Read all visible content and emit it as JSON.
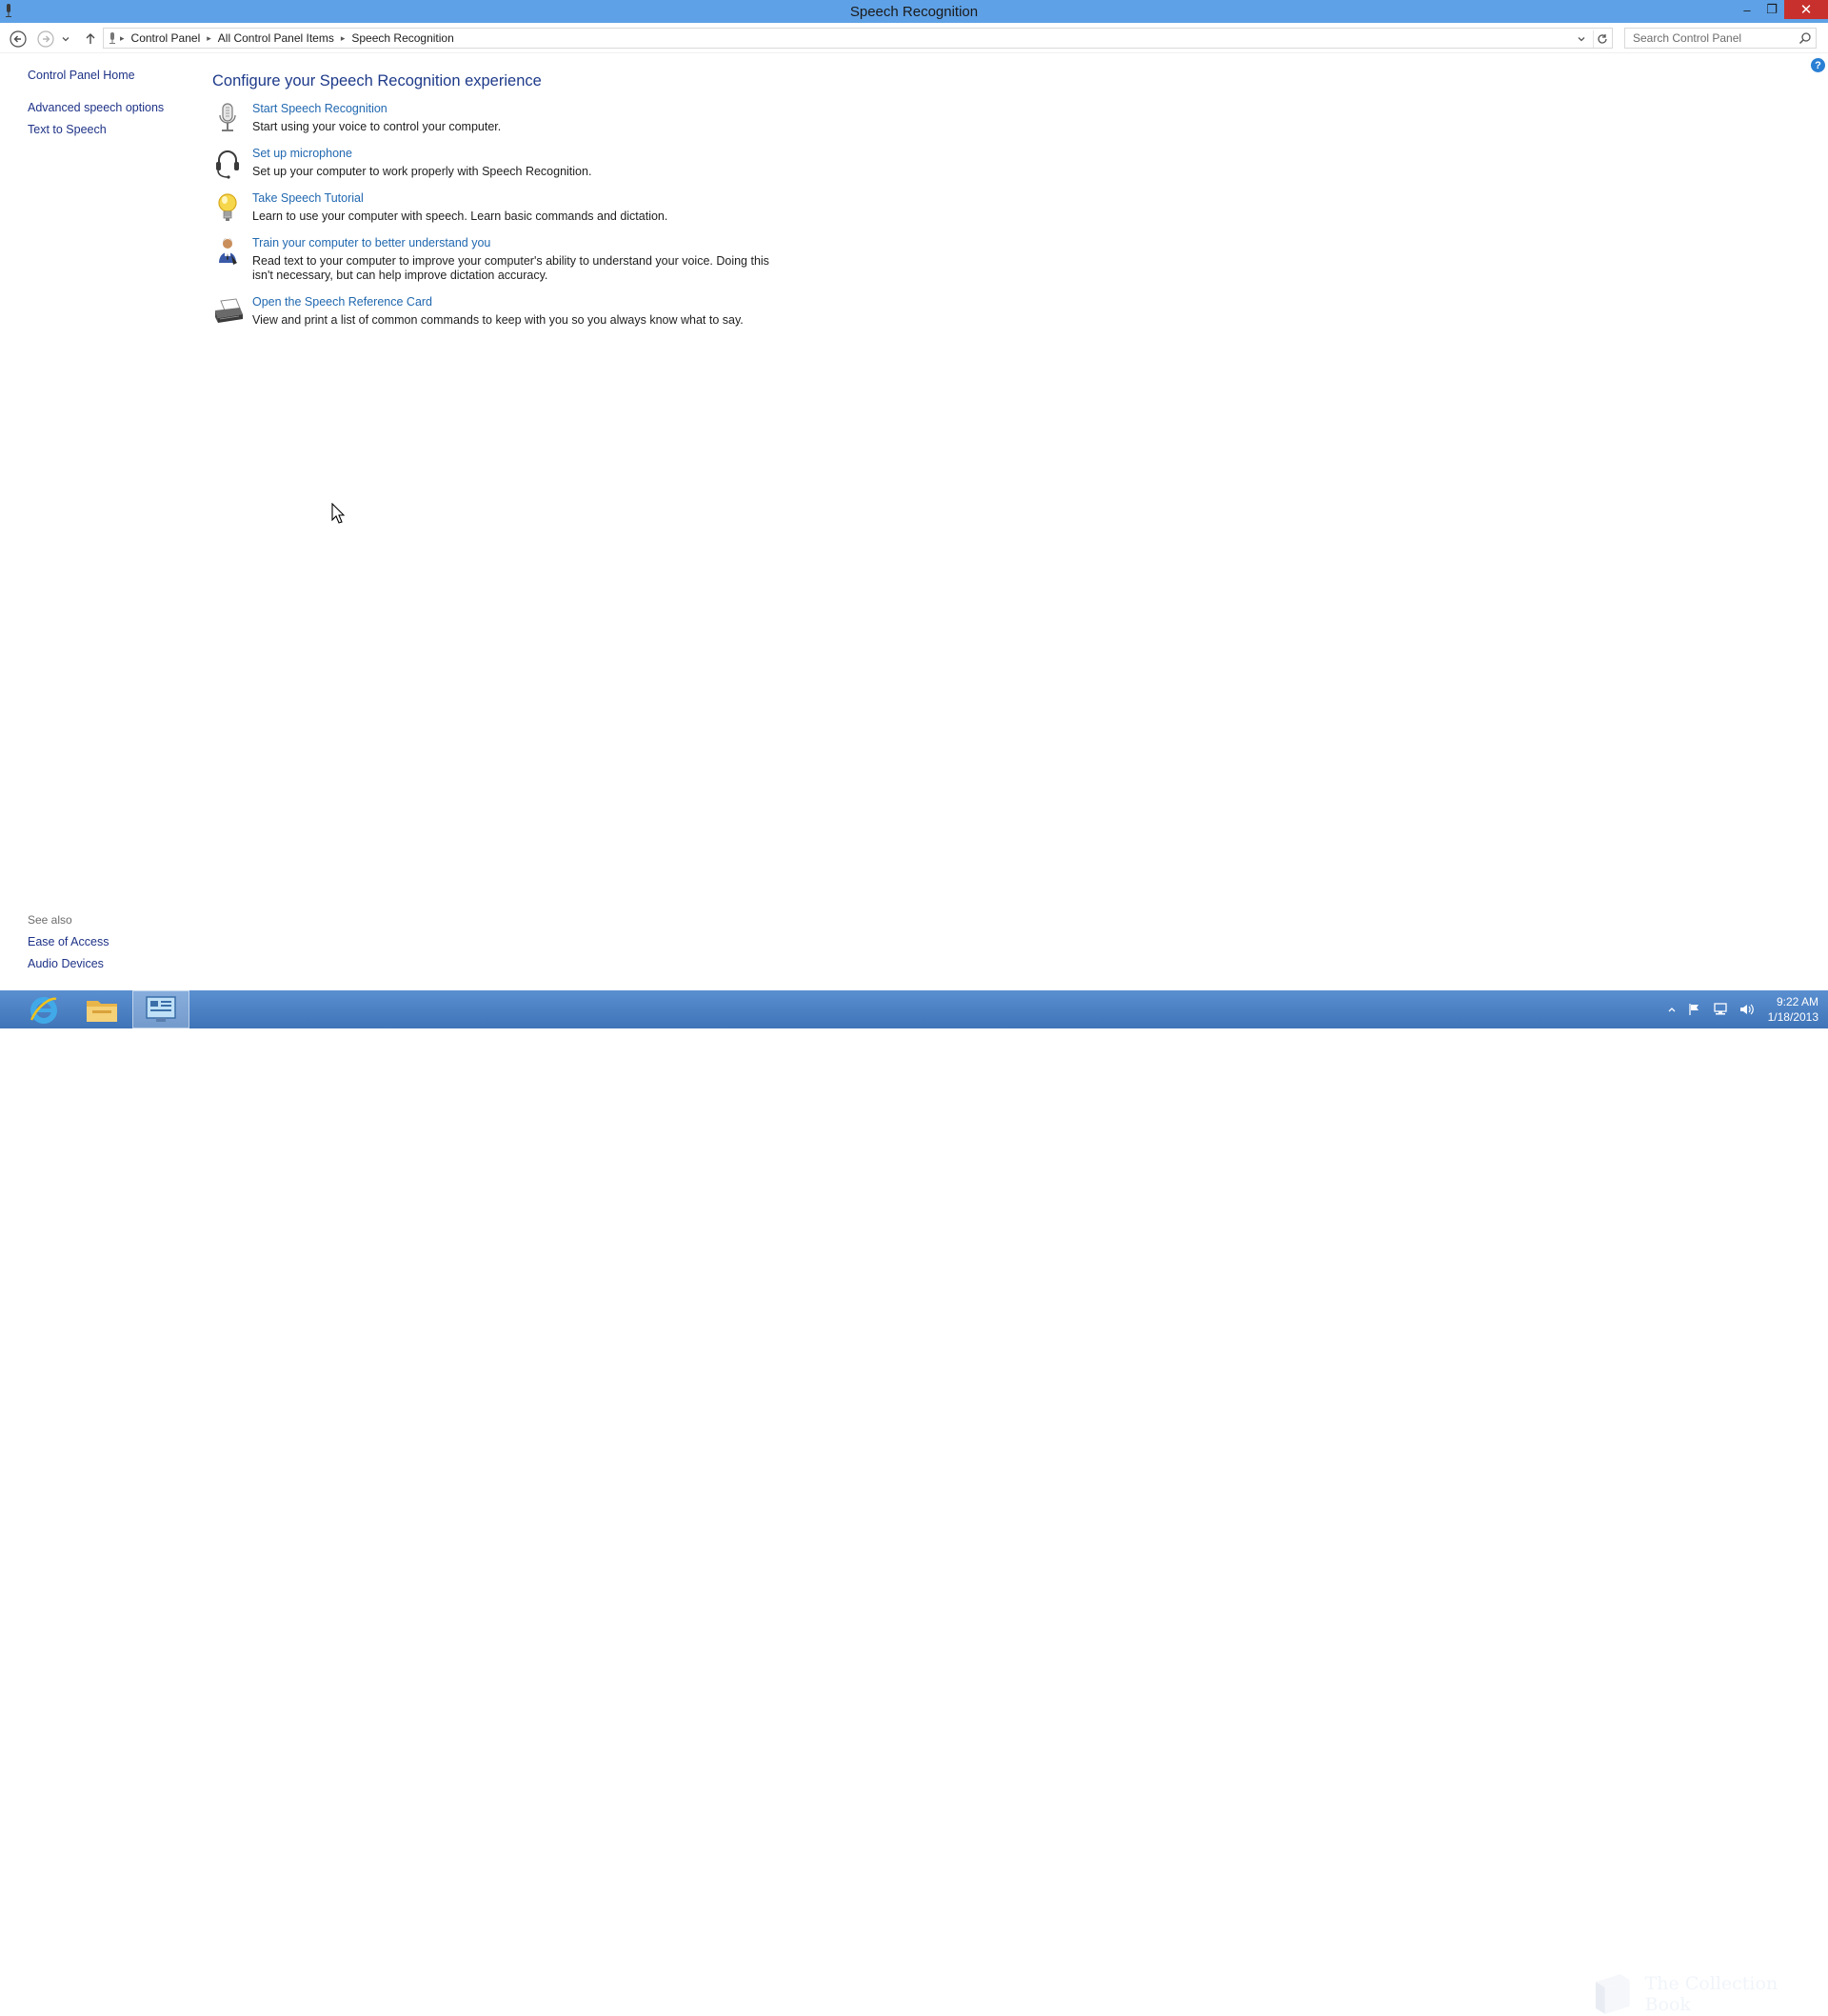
{
  "window": {
    "title": "Speech Recognition",
    "minimize_label": "–",
    "restore_label": "❐",
    "close_label": "✕"
  },
  "address": {
    "crumbs": [
      "Control Panel",
      "All Control Panel Items",
      "Speech Recognition"
    ],
    "search_placeholder": "Search Control Panel"
  },
  "sidebar": {
    "home": "Control Panel Home",
    "items": [
      "Advanced speech options",
      "Text to Speech"
    ],
    "see_also_title": "See also",
    "see_also": [
      "Ease of Access",
      "Audio Devices"
    ]
  },
  "main": {
    "title": "Configure your Speech Recognition experience",
    "tasks": [
      {
        "link": "Start Speech Recognition",
        "desc": "Start using your voice to control your computer.",
        "icon": "microphone-icon"
      },
      {
        "link": "Set up microphone",
        "desc": "Set up your computer to work properly with Speech Recognition.",
        "icon": "headset-icon"
      },
      {
        "link": "Take Speech Tutorial",
        "desc": "Learn to use your computer with speech.  Learn basic commands and dictation.",
        "icon": "lightbulb-icon"
      },
      {
        "link": "Train your computer to better understand you",
        "desc": "Read text to your computer to improve your computer's ability to understand your voice.  Doing this isn't necessary, but can help improve dictation accuracy.",
        "icon": "user-training-icon"
      },
      {
        "link": "Open the Speech Reference Card",
        "desc": "View and print a list of common commands to keep with you so you always know what to say.",
        "icon": "printer-icon"
      }
    ]
  },
  "taskbar": {
    "apps": [
      "internet-explorer-icon",
      "file-explorer-icon",
      "control-panel-icon"
    ],
    "clock_time": "9:22 AM",
    "clock_date": "1/18/2013",
    "watermark": "The Collection Book"
  },
  "colors": {
    "titlebar": "#5ea1e6",
    "link": "#2168b0",
    "taskbar": "#4a7fc0",
    "close": "#c7302c"
  }
}
